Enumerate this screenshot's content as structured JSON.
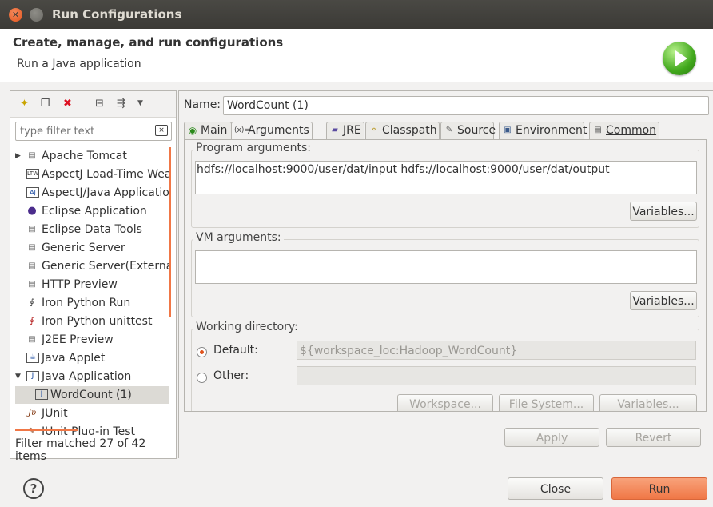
{
  "window": {
    "title": "Run Configurations"
  },
  "banner": {
    "title": "Create, manage, and run configurations",
    "subtitle": "Run a Java application",
    "icon": "run-icon"
  },
  "filter": {
    "placeholder": "type filter text",
    "status": "Filter matched 27 of 42 items"
  },
  "tree": {
    "items": [
      {
        "label": "Apache Tomcat",
        "icon": "tomcat-icon",
        "expandable": true
      },
      {
        "label": "AspectJ Load-Time Wea",
        "icon": "ltw-icon"
      },
      {
        "label": "AspectJ/Java Applicatio",
        "icon": "aj-icon"
      },
      {
        "label": "Eclipse Application",
        "icon": "eclipse-icon"
      },
      {
        "label": "Eclipse Data Tools",
        "icon": "server-icon"
      },
      {
        "label": "Generic Server",
        "icon": "server-icon"
      },
      {
        "label": "Generic Server(External",
        "icon": "server-icon"
      },
      {
        "label": "HTTP Preview",
        "icon": "server-icon"
      },
      {
        "label": "Iron Python Run",
        "icon": "python-icon"
      },
      {
        "label": "Iron Python unittest",
        "icon": "python-test-icon"
      },
      {
        "label": "J2EE Preview",
        "icon": "server-icon"
      },
      {
        "label": "Java Applet",
        "icon": "applet-icon"
      },
      {
        "label": "Java Application",
        "icon": "java-app-icon",
        "expanded": true
      },
      {
        "label": "WordCount (1)",
        "icon": "java-app-icon",
        "child": true,
        "selected": true
      },
      {
        "label": "JUnit",
        "icon": "junit-icon"
      },
      {
        "label": "JUnit Plug-in Test",
        "icon": "junit-plugin-icon"
      }
    ]
  },
  "config": {
    "name_label": "Name:",
    "name_value": "WordCount (1)"
  },
  "tabs": [
    {
      "label": "Main",
      "icon": "main-tab-icon"
    },
    {
      "label": "Arguments",
      "icon": "arguments-tab-icon",
      "active": true
    },
    {
      "label": "JRE",
      "icon": "jre-tab-icon"
    },
    {
      "label": "Classpath",
      "icon": "classpath-tab-icon"
    },
    {
      "label": "Source",
      "icon": "source-tab-icon"
    },
    {
      "label": "Environment",
      "icon": "environment-tab-icon"
    },
    {
      "label": "Common",
      "icon": "common-tab-icon"
    }
  ],
  "arguments": {
    "program_label": "Program arguments:",
    "program_value": "hdfs://localhost:9000/user/dat/input hdfs://localhost:9000/user/dat/output",
    "vm_label": "VM arguments:",
    "vm_value": "",
    "variables_label": "Variables...",
    "working_dir_label": "Working directory:",
    "default_label": "Default:",
    "default_value": "${workspace_loc:Hadoop_WordCount}",
    "other_label": "Other:",
    "other_value": "",
    "workspace_button": "Workspace...",
    "filesystem_button": "File System...",
    "variables_button": "Variables..."
  },
  "actions": {
    "apply": "Apply",
    "revert": "Revert",
    "close": "Close",
    "run": "Run"
  },
  "colors": {
    "accent": "#f07746",
    "title_bar": "#3c3b37"
  }
}
